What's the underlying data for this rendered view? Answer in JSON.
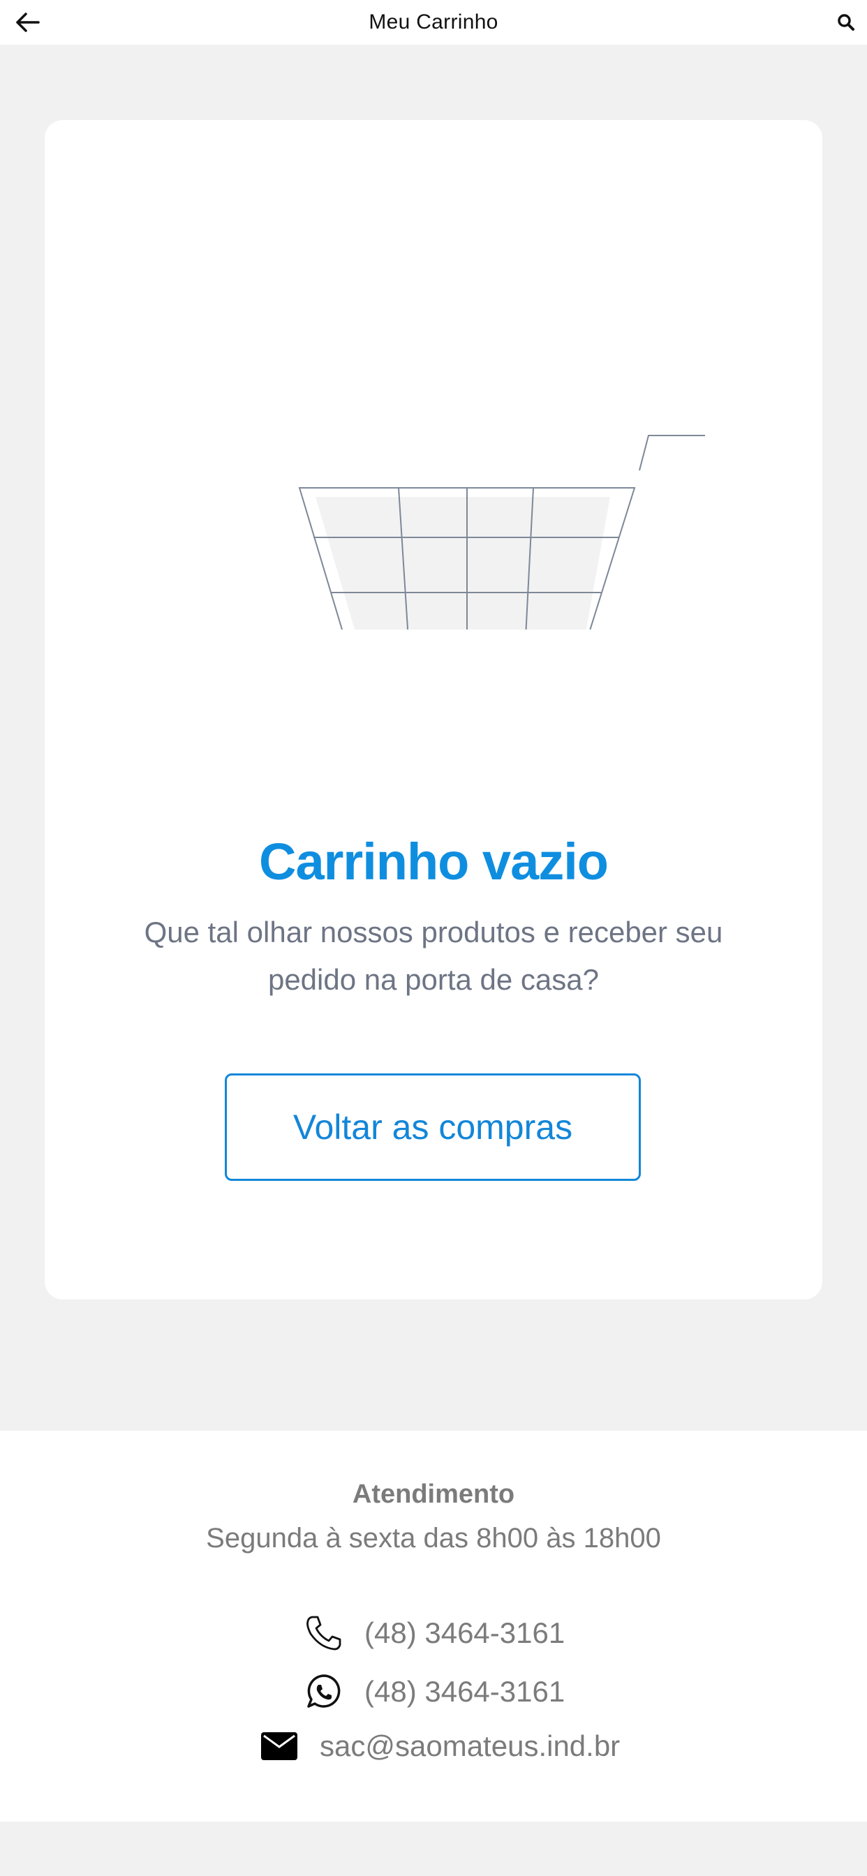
{
  "header": {
    "title": "Meu Carrinho",
    "back_icon": "arrow-left-icon",
    "search_icon": "search-icon"
  },
  "empty_state": {
    "illustration": "shopping-cart-illustration",
    "title": "Carrinho vazio",
    "subtitle": "Que tal olhar nossos produtos e receber seu pedido na porta de casa?",
    "button_label": "Voltar as compras"
  },
  "footer": {
    "title": "Atendimento",
    "hours": "Segunda à sexta das 8h00 às 18h00",
    "contacts": [
      {
        "icon": "phone-icon",
        "value": "(48) 3464-3161"
      },
      {
        "icon": "whatsapp-icon",
        "value": "(48) 3464-3161"
      },
      {
        "icon": "mail-icon",
        "value": "sac@saomateus.ind.br"
      }
    ]
  },
  "colors": {
    "accent": "#1386d8",
    "title_blue": "#0f8ee0",
    "text_gray": "#6d7484",
    "background": "#f1f1f1",
    "leaf_dark": "#132c4b",
    "leaf_light": "#a0a8b3",
    "wheel": "#6f7e90"
  }
}
